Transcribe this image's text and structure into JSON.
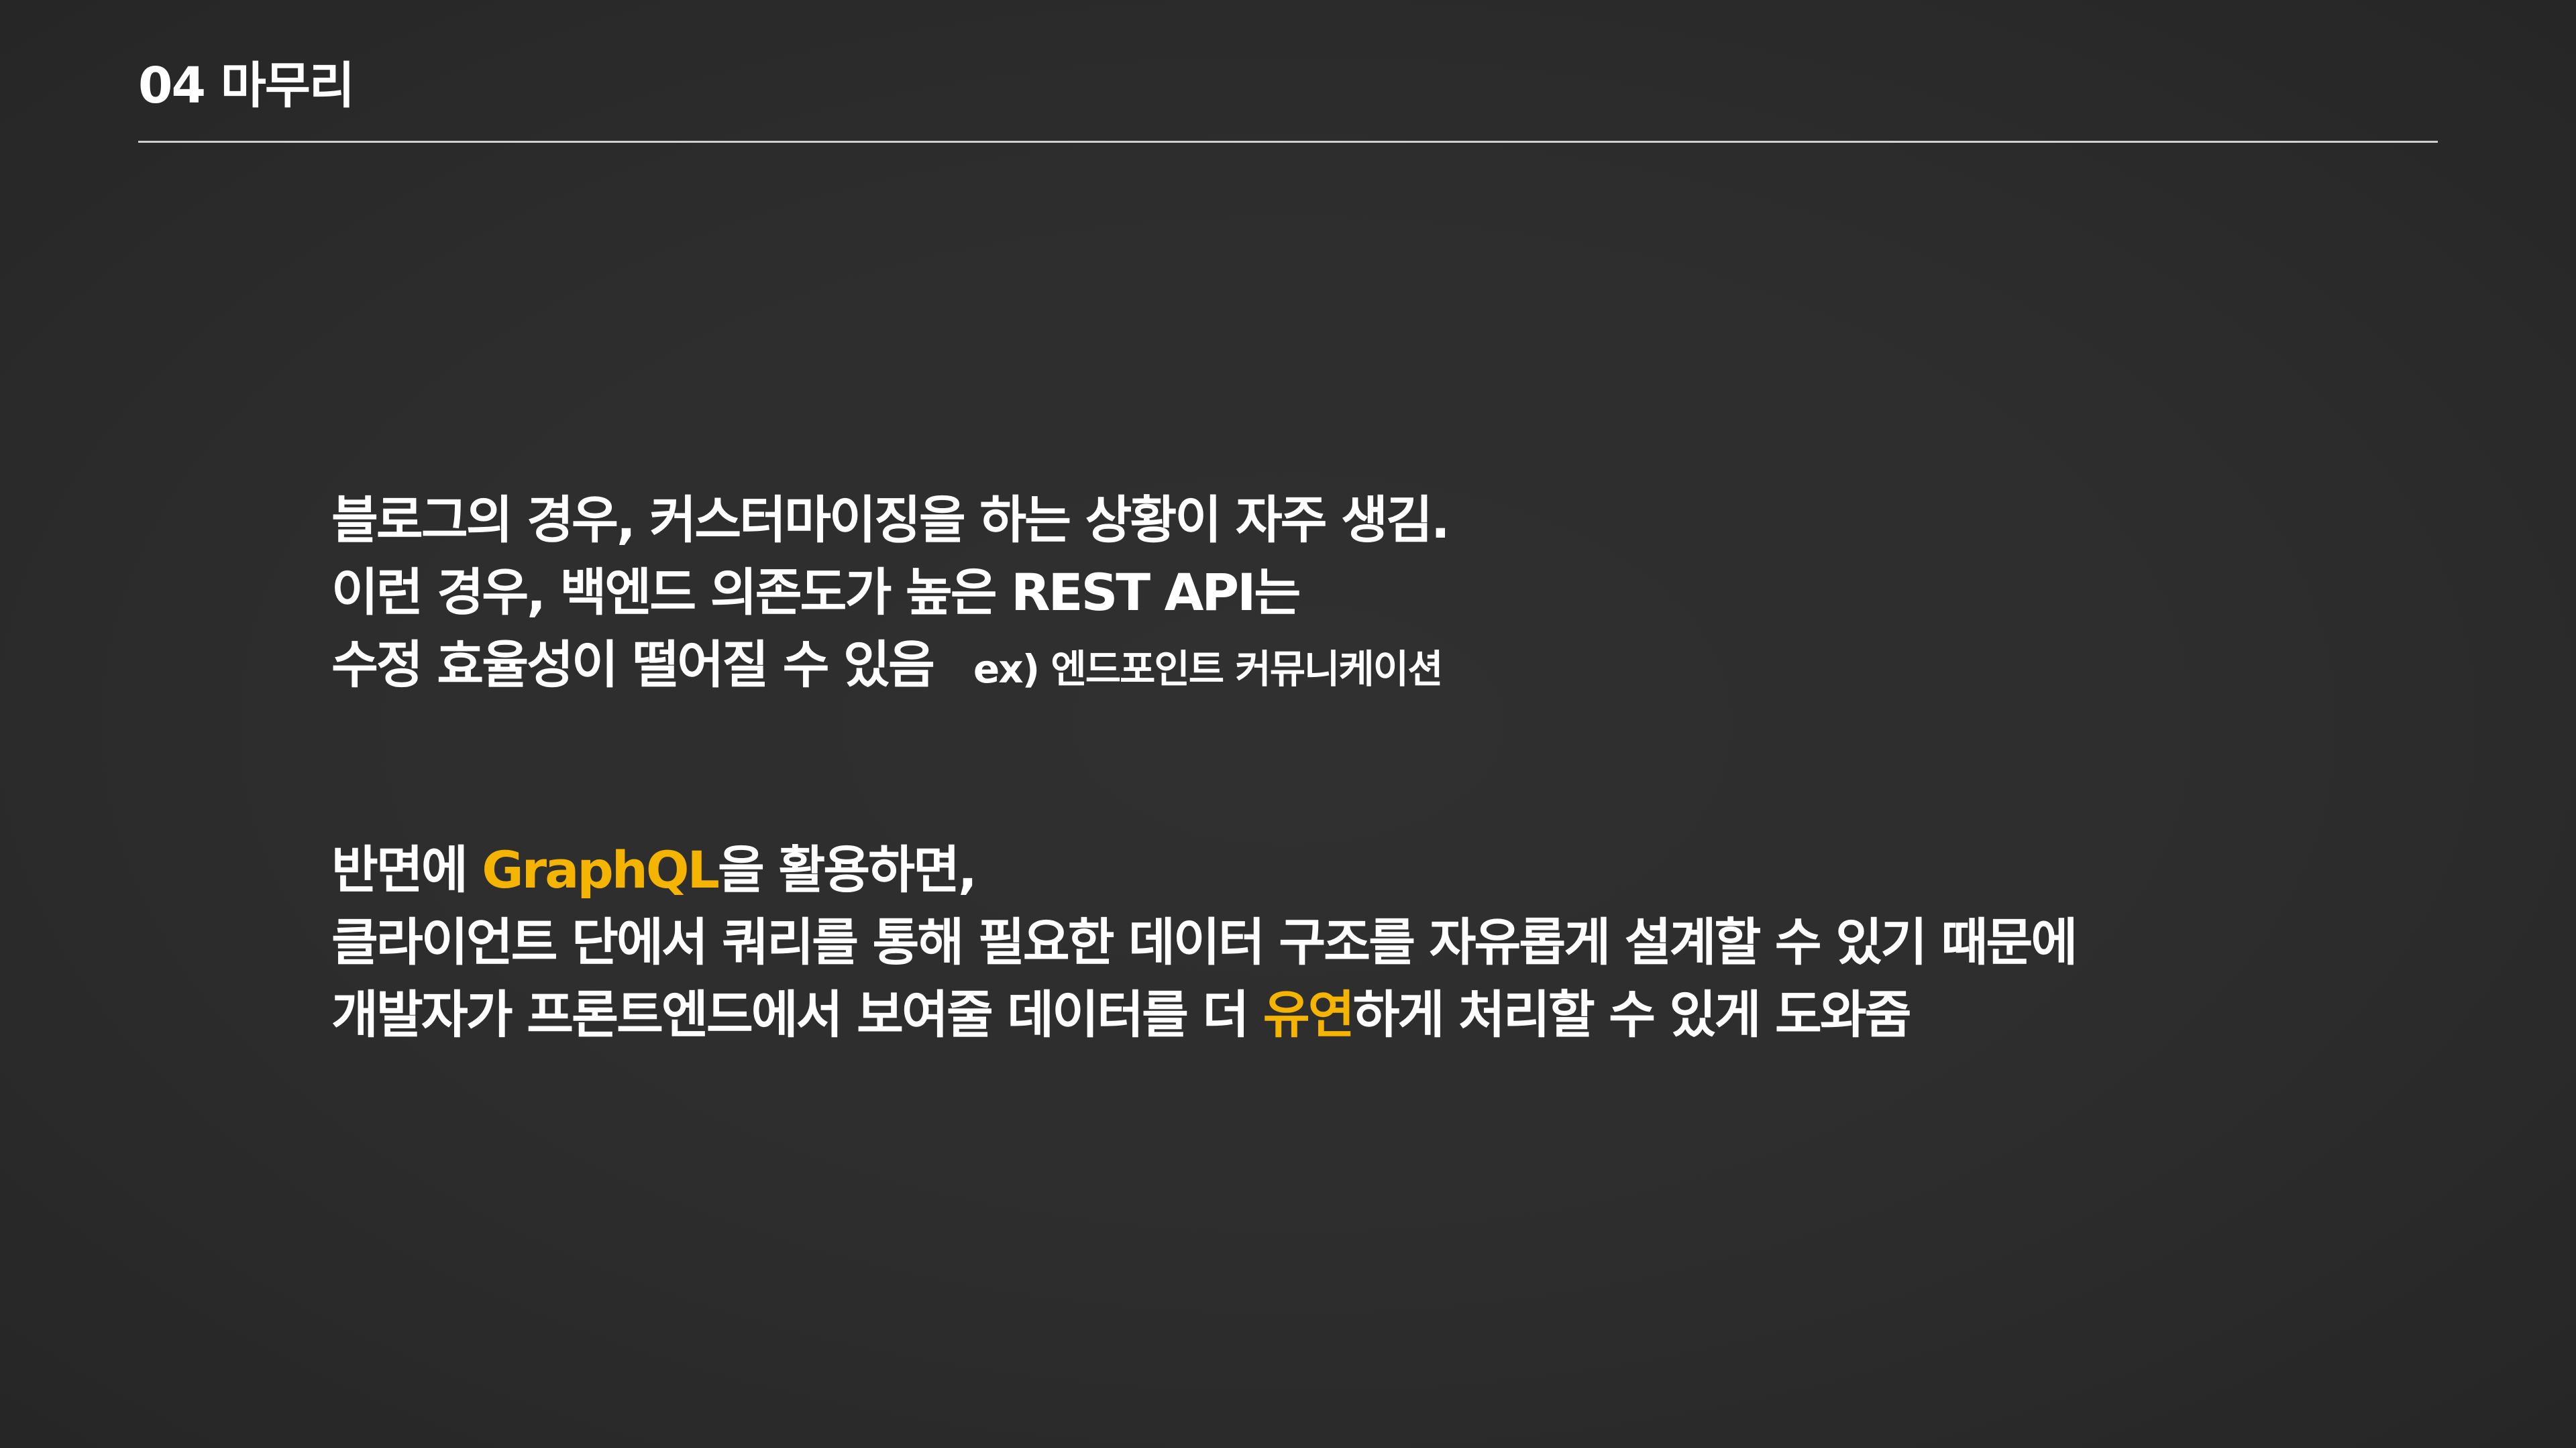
{
  "header": {
    "title": "04 마무리"
  },
  "block1": {
    "line1": "블로그의 경우, 커스터마이징을 하는 상황이 자주 생김.",
    "line2": "이런 경우, 백엔드 의존도가 높은 REST API는",
    "line3": "수정 효율성이 떨어질 수 있음",
    "example": "ex) 엔드포인트 커뮤니케이션"
  },
  "block2": {
    "line1_pre": "반면에 ",
    "line1_highlight": "GraphQL",
    "line1_post": "을 활용하면,",
    "line2": "클라이언트 단에서  쿼리를 통해 필요한 데이터 구조를 자유롭게 설계할 수 있기 때문에",
    "line3_pre": "개발자가 프론트엔드에서 보여줄 데이터를 더 ",
    "line3_highlight": "유연",
    "line3_post": "하게 처리할 수 있게 도와줌"
  },
  "colors": {
    "background": "#2d2d2d",
    "text": "#ffffff",
    "highlight": "#f5b400",
    "divider": "#d0d0d0"
  }
}
